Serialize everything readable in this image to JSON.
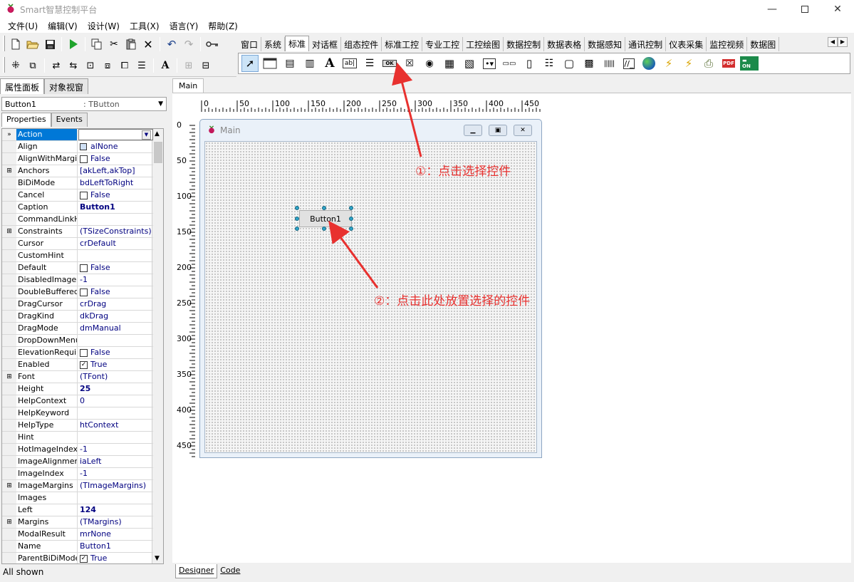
{
  "window": {
    "title": "Smart智慧控制平台",
    "icon": "raspberry-icon"
  },
  "menubar": [
    "文件(U)",
    "编辑(V)",
    "设计(W)",
    "工具(X)",
    "语言(Y)",
    "帮助(Z)"
  ],
  "palette": {
    "tabs": [
      "窗口",
      "系统",
      "标准",
      "对话框",
      "组态控件",
      "标准工控",
      "专业工控",
      "工控绘图",
      "数据控制",
      "数据表格",
      "数据感知",
      "通讯控制",
      "仪表采集",
      "监控视频",
      "数据图"
    ],
    "active_tab": "标准",
    "selected_tool_icon": "button-ok-icon",
    "button_icon_label": "OK"
  },
  "left_panel": {
    "tabs": [
      "属性面板",
      "对象视窗"
    ],
    "object_name": "Button1",
    "object_type": ": TButton",
    "editor_tabs": [
      "Properties",
      "Events"
    ],
    "status": "All shown"
  },
  "properties": [
    {
      "name": "Action",
      "value": "",
      "selected": true,
      "gutter": "»"
    },
    {
      "name": "Align",
      "value": "alNone",
      "box": "align"
    },
    {
      "name": "AlignWithMargins",
      "value": "False",
      "check": ""
    },
    {
      "name": "Anchors",
      "value": "[akLeft,akTop]",
      "gutter": "⊞"
    },
    {
      "name": "BiDiMode",
      "value": "bdLeftToRight"
    },
    {
      "name": "Cancel",
      "value": "False",
      "check": ""
    },
    {
      "name": "Caption",
      "value": "Button1",
      "bold": true
    },
    {
      "name": "CommandLinkHint",
      "value": ""
    },
    {
      "name": "Constraints",
      "value": "(TSizeConstraints)",
      "gutter": "⊞"
    },
    {
      "name": "Cursor",
      "value": "crDefault"
    },
    {
      "name": "CustomHint",
      "value": ""
    },
    {
      "name": "Default",
      "value": "False",
      "check": ""
    },
    {
      "name": "DisabledImageIndex",
      "value": "-1"
    },
    {
      "name": "DoubleBuffered",
      "value": "False",
      "check": ""
    },
    {
      "name": "DragCursor",
      "value": "crDrag"
    },
    {
      "name": "DragKind",
      "value": "dkDrag"
    },
    {
      "name": "DragMode",
      "value": "dmManual"
    },
    {
      "name": "DropDownMenu",
      "value": ""
    },
    {
      "name": "ElevationRequired",
      "value": "False",
      "check": ""
    },
    {
      "name": "Enabled",
      "value": "True",
      "check": "✓"
    },
    {
      "name": "Font",
      "value": "(TFont)",
      "gutter": "⊞"
    },
    {
      "name": "Height",
      "value": "25",
      "bold": true
    },
    {
      "name": "HelpContext",
      "value": "0"
    },
    {
      "name": "HelpKeyword",
      "value": ""
    },
    {
      "name": "HelpType",
      "value": "htContext"
    },
    {
      "name": "Hint",
      "value": ""
    },
    {
      "name": "HotImageIndex",
      "value": "-1"
    },
    {
      "name": "ImageAlignment",
      "value": "iaLeft"
    },
    {
      "name": "ImageIndex",
      "value": "-1"
    },
    {
      "name": "ImageMargins",
      "value": "(TImageMargins)",
      "gutter": "⊞"
    },
    {
      "name": "Images",
      "value": ""
    },
    {
      "name": "Left",
      "value": "124",
      "bold": true
    },
    {
      "name": "Margins",
      "value": "(TMargins)",
      "gutter": "⊞"
    },
    {
      "name": "ModalResult",
      "value": "mrNone"
    },
    {
      "name": "Name",
      "value": "Button1"
    },
    {
      "name": "ParentBiDiMode",
      "value": "True",
      "check": "✓"
    }
  ],
  "designer": {
    "tab": "Main",
    "form_title": "Main",
    "button_caption": "Button1",
    "bottom_tabs": [
      "Designer",
      "Code"
    ],
    "hruler_labels": [
      "0",
      "50",
      "100",
      "150",
      "200",
      "250",
      "300",
      "350",
      "400",
      "450"
    ],
    "vruler_labels": [
      "0",
      "50",
      "100",
      "150",
      "200",
      "250",
      "300",
      "350",
      "400",
      "450"
    ]
  },
  "annotations": {
    "step1": "①：点击选择控件",
    "step2": "②：点击此处放置选择的控件",
    "color": "#e8312f"
  }
}
